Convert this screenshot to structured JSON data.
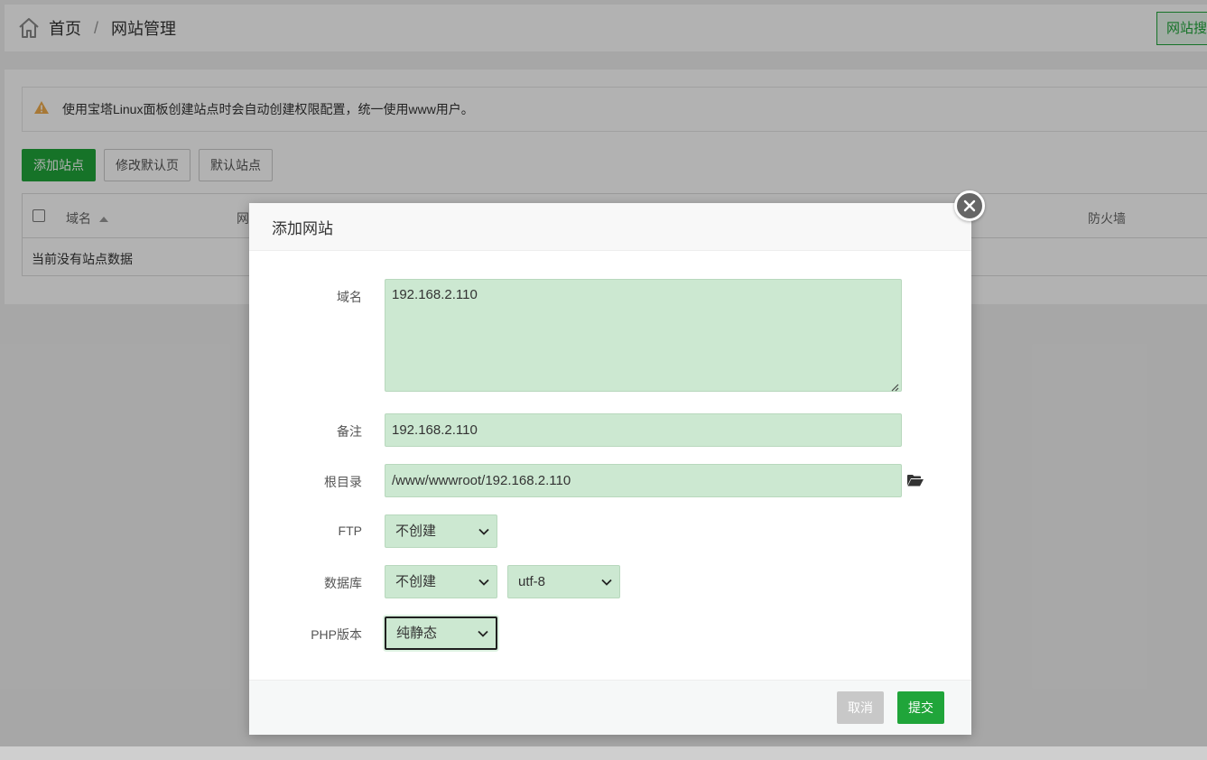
{
  "breadcrumb": {
    "home_label": "首页",
    "separator": "/",
    "current_label": "网站管理"
  },
  "header": {
    "site_search_button": "网站搜"
  },
  "alert": {
    "text": "使用宝塔Linux面板创建站点时会自动创建权限配置，统一使用www用户。",
    "icon": "warning-icon",
    "icon_color": "#f0ad4e"
  },
  "toolbar": {
    "add_site": "添加站点",
    "modify_default_page": "修改默认页",
    "default_site": "默认站点"
  },
  "table": {
    "columns": {
      "domain": "域名",
      "col2_partial": "网",
      "firewall": "防火墙"
    },
    "empty_text": "当前没有站点数据"
  },
  "modal": {
    "title": "添加网站",
    "fields": {
      "domain_label": "域名",
      "domain_value": "192.168.2.110",
      "remark_label": "备注",
      "remark_value": "192.168.2.110",
      "root_label": "根目录",
      "root_value": "/www/wwwroot/192.168.2.110",
      "ftp_label": "FTP",
      "ftp_value": "不创建",
      "db_label": "数据库",
      "db_value": "不创建",
      "db_charset_value": "utf-8",
      "php_label": "PHP版本",
      "php_value": "纯静态"
    },
    "buttons": {
      "cancel": "取消",
      "submit": "提交"
    }
  },
  "colors": {
    "brand_green": "#20a53a",
    "field_bg": "#cce8d1"
  }
}
